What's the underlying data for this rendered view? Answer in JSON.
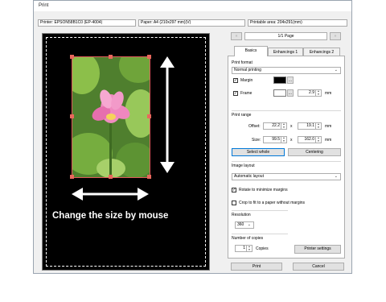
{
  "window": {
    "title": "Print"
  },
  "info": {
    "printer": "Printer: EPSON58B1C0 (EP-4004)",
    "paper": "Paper: A4 (210x297 mm)(V)",
    "printable": "Printable area: 204x291(mm)"
  },
  "pager": {
    "page_label": "1/1 Page",
    "prev_icon": "double-left-arrow",
    "next_icon": "double-right-arrow"
  },
  "preview": {
    "hint": "Change the size by mouse"
  },
  "tabs": [
    "Basics",
    "Enhancings 1",
    "Enhancings 2"
  ],
  "basics": {
    "print_format": {
      "label": "Print format",
      "value": "Normal printing"
    },
    "margin": {
      "label": "Margin",
      "checked": true,
      "color": "#000000"
    },
    "frame": {
      "label": "Frame",
      "checked": true,
      "color": "#ffffff",
      "width": "2.9",
      "unit": "mm"
    },
    "print_range": {
      "label": "Print range",
      "offset_label": "Offset:",
      "offset_x": "22.2",
      "offset_y": "19.1",
      "size_label": "Size:",
      "size_x": "99.5",
      "size_y": "162.0",
      "times": "x",
      "unit": "mm",
      "select_whole": "Select whole",
      "centering": "Centering"
    },
    "image_layout": {
      "label": "Image layout",
      "value": "Automatic layout",
      "rotate_label": "Rotate to minimize margins",
      "rotate_checked": true,
      "crop_label": "Crop to fit to a paper without margins",
      "crop_checked": false
    },
    "resolution": {
      "label": "Resolution",
      "value": "360"
    },
    "copies": {
      "label": "Number of copies",
      "value": "1",
      "unit": "Copies"
    },
    "printer_settings": "Printer settings"
  },
  "footer": {
    "print": "Print",
    "cancel": "Cancel"
  },
  "colors": {
    "accent": "#0078d7",
    "handle": "#e8685c",
    "preview_bg": "#000000"
  },
  "glyphs": {
    "check": "✓",
    "dropdown": "⌄",
    "spin_up": "▲",
    "spin_down": "▼",
    "ellipsis": "..."
  }
}
